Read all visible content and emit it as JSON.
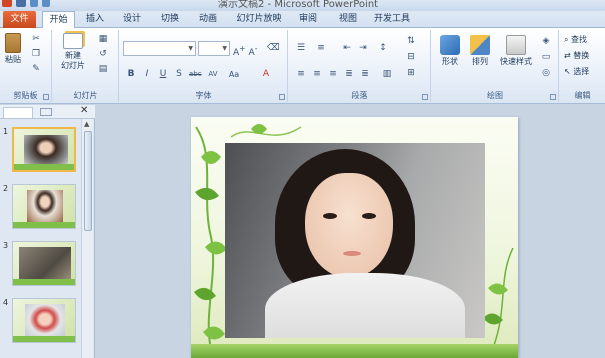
{
  "window": {
    "title": "演示文稿2 - Microsoft PowerPoint"
  },
  "tabs": [
    {
      "label": "文件"
    },
    {
      "label": "开始"
    },
    {
      "label": "插入"
    },
    {
      "label": "设计"
    },
    {
      "label": "切换"
    },
    {
      "label": "动画"
    },
    {
      "label": "幻灯片放映"
    },
    {
      "label": "审阅"
    },
    {
      "label": "视图"
    },
    {
      "label": "开发工具"
    }
  ],
  "ribbon": {
    "groups": {
      "clipboard": "剪贴板",
      "slides": "幻灯片",
      "font": "字体",
      "paragraph": "段落",
      "drawing": "绘图",
      "editing": "编辑"
    },
    "paste": "粘贴",
    "new_slide_line1": "新建",
    "new_slide_line2": "幻灯片",
    "shapes": "形状",
    "arrange": "排列",
    "quick_styles": "快速样式",
    "find": "查找",
    "replace": "替换",
    "select": "选择"
  },
  "slides": [
    {
      "number": "1"
    },
    {
      "number": "2"
    },
    {
      "number": "3"
    },
    {
      "number": "4"
    }
  ],
  "colors": {
    "file_tab": "#d0542a",
    "ribbon_bg": "#e6eef8",
    "selected_thumb_border": "#f0b84a",
    "slide_green": "#6fb23a"
  }
}
